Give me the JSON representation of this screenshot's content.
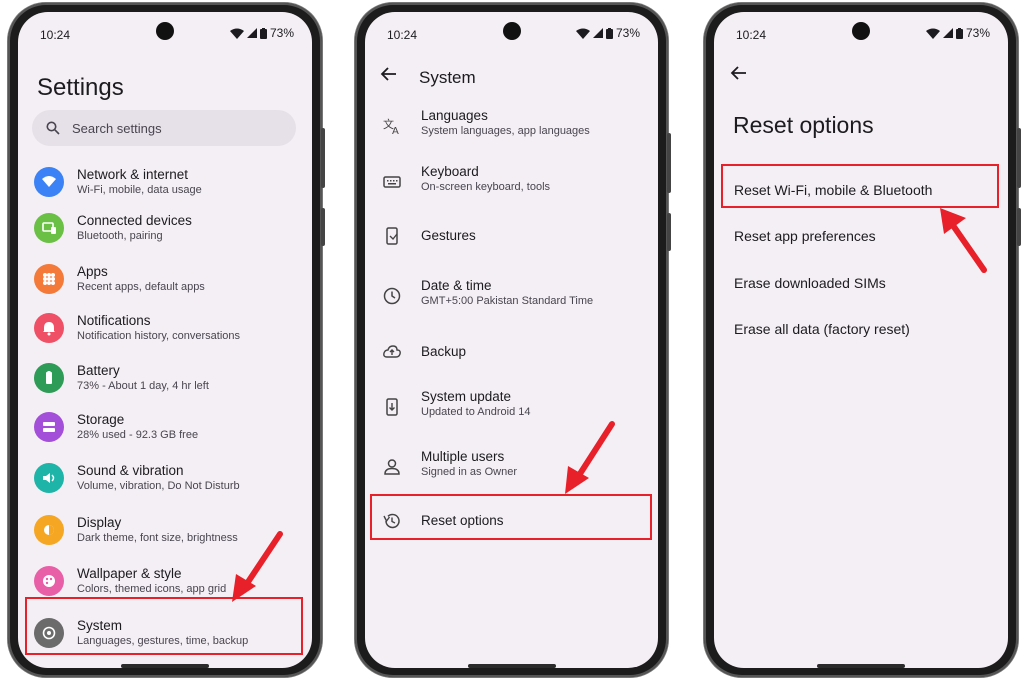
{
  "status": {
    "time": "10:24",
    "battery": "73%"
  },
  "phone1": {
    "title": "Settings",
    "search_placeholder": "Search settings",
    "items": [
      {
        "title": "Network & internet",
        "subtitle": "Wi-Fi, mobile, data usage",
        "icon": "wifi-icon",
        "color": "#3b82f6"
      },
      {
        "title": "Connected devices",
        "subtitle": "Bluetooth, pairing",
        "icon": "devices-icon",
        "color": "#6abf45"
      },
      {
        "title": "Apps",
        "subtitle": "Recent apps, default apps",
        "icon": "apps-icon",
        "color": "#f47a3a"
      },
      {
        "title": "Notifications",
        "subtitle": "Notification history, conversations",
        "icon": "bell-icon",
        "color": "#ef5066"
      },
      {
        "title": "Battery",
        "subtitle": "73% - About 1 day, 4 hr left",
        "icon": "battery-icon",
        "color": "#2e9b56"
      },
      {
        "title": "Storage",
        "subtitle": "28% used - 92.3 GB free",
        "icon": "storage-icon",
        "color": "#a44fd9"
      },
      {
        "title": "Sound & vibration",
        "subtitle": "Volume, vibration, Do Not Disturb",
        "icon": "sound-icon",
        "color": "#1fb4a8"
      },
      {
        "title": "Display",
        "subtitle": "Dark theme, font size, brightness",
        "icon": "display-icon",
        "color": "#f5a623"
      },
      {
        "title": "Wallpaper & style",
        "subtitle": "Colors, themed icons, app grid",
        "icon": "palette-icon",
        "color": "#e85fa8"
      },
      {
        "title": "System",
        "subtitle": "Languages, gestures, time, backup",
        "icon": "system-icon",
        "color": "#6b6b6b"
      }
    ]
  },
  "phone2": {
    "title": "System",
    "items": [
      {
        "title": "Languages",
        "subtitle": "System languages, app languages",
        "icon": "translate-icon"
      },
      {
        "title": "Keyboard",
        "subtitle": "On-screen keyboard, tools",
        "icon": "keyboard-icon"
      },
      {
        "title": "Gestures",
        "subtitle": "",
        "icon": "gestures-icon"
      },
      {
        "title": "Date & time",
        "subtitle": "GMT+5:00 Pakistan Standard Time",
        "icon": "clock-icon"
      },
      {
        "title": "Backup",
        "subtitle": "",
        "icon": "cloud-backup-icon"
      },
      {
        "title": "System update",
        "subtitle": "Updated to Android 14",
        "icon": "system-update-icon"
      },
      {
        "title": "Multiple users",
        "subtitle": "Signed in as Owner",
        "icon": "person-icon"
      },
      {
        "title": "Reset options",
        "subtitle": "",
        "icon": "history-icon"
      }
    ]
  },
  "phone3": {
    "title": "Reset options",
    "items": [
      "Reset Wi-Fi, mobile & Bluetooth",
      "Reset app preferences",
      "Erase downloaded SIMs",
      "Erase all data (factory reset)"
    ]
  },
  "colors": {
    "highlight": "#e8202a",
    "screen_bg": "#f4eff4"
  }
}
